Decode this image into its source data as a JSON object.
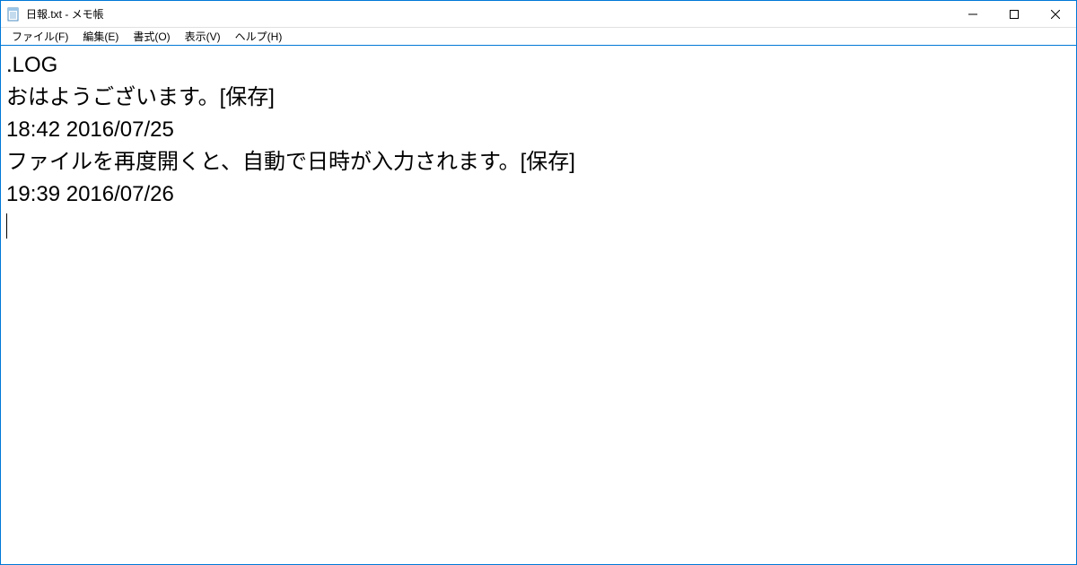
{
  "window": {
    "title": "日報.txt - メモ帳"
  },
  "menu": {
    "file": "ファイル(F)",
    "edit": "編集(E)",
    "format": "書式(O)",
    "view": "表示(V)",
    "help": "ヘルプ(H)"
  },
  "content": {
    "line1": ".LOG",
    "line2": "おはようございます。[保存]",
    "line3": "18:42 2016/07/25",
    "line4": "ファイルを再度開くと、自動で日時が入力されます。[保存]",
    "line5": "19:39 2016/07/26"
  }
}
